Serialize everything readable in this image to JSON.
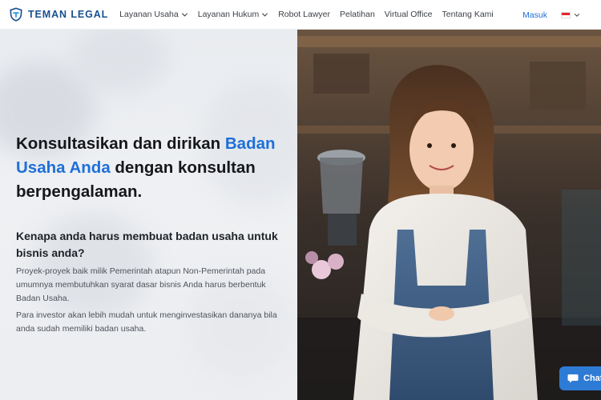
{
  "brand": {
    "name": "TEMAN LEGAL"
  },
  "nav": {
    "items": [
      {
        "label": "Layanan Usaha",
        "dropdown": true
      },
      {
        "label": "Layanan Hukum",
        "dropdown": true
      },
      {
        "label": "Robot Lawyer",
        "dropdown": false
      },
      {
        "label": "Pelatihan",
        "dropdown": false
      },
      {
        "label": "Virtual Office",
        "dropdown": false
      },
      {
        "label": "Tentang Kami",
        "dropdown": false
      }
    ],
    "login_label": "Masuk",
    "language_flag": "indonesia-flag-icon"
  },
  "hero": {
    "headline_part1": "Konsultasikan dan dirikan ",
    "headline_highlight": "Badan Usaha Anda",
    "headline_part2": " dengan konsultan berpengalaman.",
    "subheading": "Kenapa anda harus membuat badan usaha untuk bisnis anda?",
    "paragraph1": "Proyek-proyek baik milik Pemerintah atapun Non-Pemerintah pada umumnya membutuhkan syarat dasar bisnis Anda harus berbentuk Badan Usaha.",
    "paragraph2": "Para investor akan lebih mudah untuk menginvestasikan dananya bila anda sudah memiliki badan usaha."
  },
  "chat": {
    "label": "Chat",
    "icon": "chat-bubble-icon"
  },
  "colors": {
    "brand": "#1a4f8f",
    "accent": "#1e6fd9",
    "chat": "#2e7bd6"
  }
}
